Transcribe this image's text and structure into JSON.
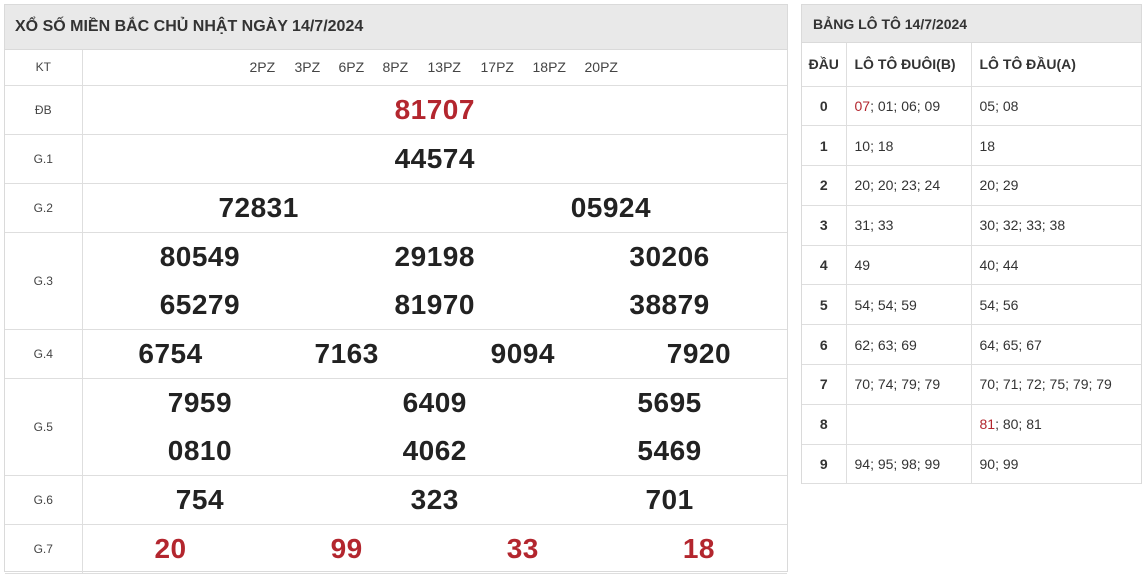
{
  "results": {
    "title": "XỔ SỐ MIỀN BẮC CHỦ NHẬT NGÀY 14/7/2024",
    "kt_label": "KT",
    "codes": [
      "2PZ",
      "3PZ",
      "6PZ",
      "8PZ",
      "13PZ",
      "17PZ",
      "18PZ",
      "20PZ"
    ],
    "prizes": {
      "db": {
        "label": "ĐB",
        "numbers": [
          "81707"
        ]
      },
      "g1": {
        "label": "G.1",
        "numbers": [
          "44574"
        ]
      },
      "g2": {
        "label": "G.2",
        "numbers": [
          "72831",
          "05924"
        ]
      },
      "g3": {
        "label": "G.3",
        "numbers": [
          "80549",
          "29198",
          "30206",
          "65279",
          "81970",
          "38879"
        ]
      },
      "g4": {
        "label": "G.4",
        "numbers": [
          "6754",
          "7163",
          "9094",
          "7920"
        ]
      },
      "g5": {
        "label": "G.5",
        "numbers": [
          "7959",
          "6409",
          "5695",
          "0810",
          "4062",
          "5469"
        ]
      },
      "g6": {
        "label": "G.6",
        "numbers": [
          "754",
          "323",
          "701"
        ]
      },
      "g7": {
        "label": "G.7",
        "numbers": [
          "20",
          "99",
          "33",
          "18"
        ]
      }
    },
    "colors": {
      "highlight": "#b3262e",
      "header_bg": "#e9e9e9"
    }
  },
  "loto": {
    "title": "BẢNG LÔ TÔ 14/7/2024",
    "headers": [
      "ĐẦU",
      "LÔ TÔ ĐUÔI(B)",
      "LÔ TÔ ĐẦU(A)"
    ],
    "rows": [
      {
        "head": "0",
        "tail_hl": "07",
        "tail": "; 01; 06; 09",
        "front_hl": "",
        "front": "05; 08"
      },
      {
        "head": "1",
        "tail_hl": "",
        "tail": "10; 18",
        "front_hl": "",
        "front": "18"
      },
      {
        "head": "2",
        "tail_hl": "",
        "tail": "20; 20; 23; 24",
        "front_hl": "",
        "front": "20; 29"
      },
      {
        "head": "3",
        "tail_hl": "",
        "tail": "31; 33",
        "front_hl": "",
        "front": "30; 32; 33; 38"
      },
      {
        "head": "4",
        "tail_hl": "",
        "tail": "49",
        "front_hl": "",
        "front": "40; 44"
      },
      {
        "head": "5",
        "tail_hl": "",
        "tail": "54; 54; 59",
        "front_hl": "",
        "front": "54; 56"
      },
      {
        "head": "6",
        "tail_hl": "",
        "tail": "62; 63; 69",
        "front_hl": "",
        "front": "64; 65; 67"
      },
      {
        "head": "7",
        "tail_hl": "",
        "tail": "70; 74; 79; 79",
        "front_hl": "",
        "front": "70; 71; 72; 75; 79; 79"
      },
      {
        "head": "8",
        "tail_hl": "",
        "tail": "",
        "front_hl": "81",
        "front": "; 80; 81"
      },
      {
        "head": "9",
        "tail_hl": "",
        "tail": "94; 95; 98; 99",
        "front_hl": "",
        "front": "90; 99"
      }
    ]
  }
}
